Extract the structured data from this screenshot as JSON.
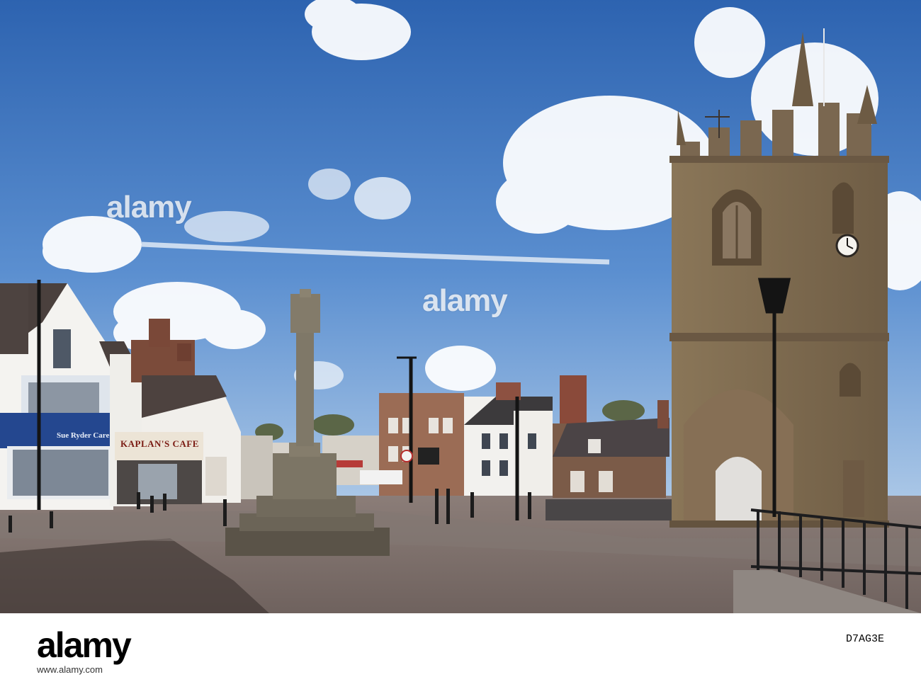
{
  "watermarks": {
    "primary": "alamy",
    "secondary": "alamy"
  },
  "signs": {
    "charity_shop": "Sue Ryder Care",
    "cafe": "KAPLAN'S CAFE"
  },
  "footer": {
    "logo_text": "alamy",
    "image_id": "D7AG3E",
    "url": "www.alamy.com"
  },
  "colors": {
    "sky_top": "#2f66b3",
    "sky_bottom": "#8fb6e2",
    "stone": "#7d6a52",
    "pavement": "#7e706b"
  },
  "icons": [
    "clock-face",
    "street-lamp",
    "war-memorial-cross"
  ]
}
